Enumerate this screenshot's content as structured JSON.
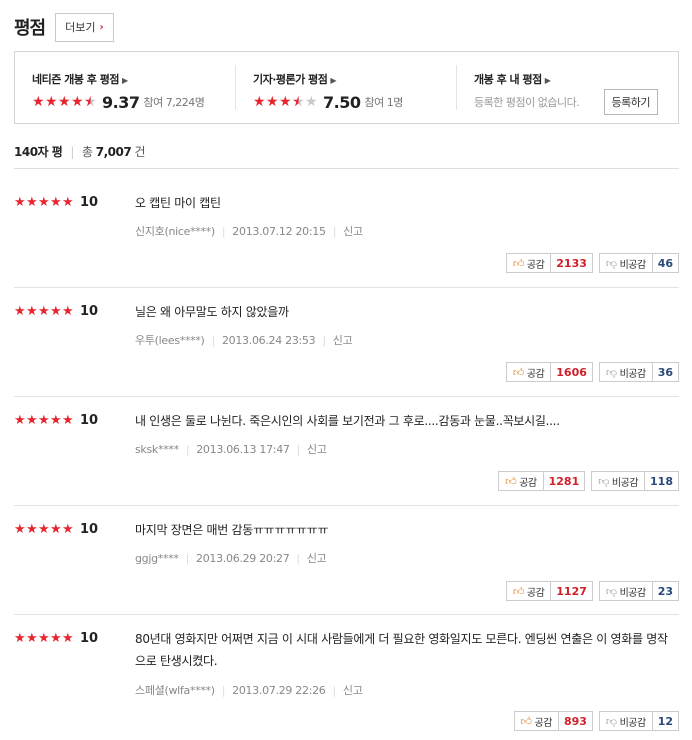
{
  "header": {
    "title": "평점",
    "more_label": "더보기"
  },
  "summary": {
    "netizen": {
      "label": "네티즌 개봉 후 평점",
      "stars": 4.5,
      "score": "9.37",
      "participants": "참여 7,224명"
    },
    "critic": {
      "label": "기자·평론가 평점",
      "stars": 3.5,
      "score": "7.50",
      "participants": "참여 1명"
    },
    "mine": {
      "label": "개봉 후 내 평점",
      "empty_text": "등록한 평점이 없습니다.",
      "register_label": "등록하기"
    }
  },
  "count_bar": {
    "label": "140자 평",
    "total_prefix": "총",
    "total": "7,007",
    "total_suffix": "건"
  },
  "vote_labels": {
    "up": "공감",
    "down": "비공감"
  },
  "report_label": "신고",
  "reviews": [
    {
      "score": "10",
      "text": "오 캡틴 마이 캡틴",
      "author": "신지호(nice****)",
      "date": "2013.07.12 20:15",
      "up": "2133",
      "down": "46"
    },
    {
      "score": "10",
      "text": "닐은 왜 아무말도 하지 않았을까",
      "author": "우투(lees****)",
      "date": "2013.06.24 23:53",
      "up": "1606",
      "down": "36"
    },
    {
      "score": "10",
      "text": "내 인생은 둘로 나뉜다. 죽은시인의 사회를 보기전과 그 후로....감동과 눈물..꼭보시길....",
      "author": "sksk****",
      "date": "2013.06.13 17:47",
      "up": "1281",
      "down": "118"
    },
    {
      "score": "10",
      "text": "마지막 장면은 매번 감동ㅠㅠㅠㅠㅠㅠㅠ",
      "author": "ggjg****",
      "date": "2013.06.29 20:27",
      "up": "1127",
      "down": "23"
    },
    {
      "score": "10",
      "text": "80년대 영화지만 어쩌면 지금 이 시대 사람들에게 더 필요한 영화일지도 모른다. 엔딩씬 연출은 이 영화를 명작으로 탄생시켰다.",
      "author": "스페셜(wlfa****)",
      "date": "2013.07.29 22:26",
      "up": "893",
      "down": "12"
    }
  ],
  "colors": {
    "star_on": "#e8252e",
    "star_off": "#c8c8c8",
    "up_count": "#d0202a",
    "down_count": "#2a4a7a"
  }
}
